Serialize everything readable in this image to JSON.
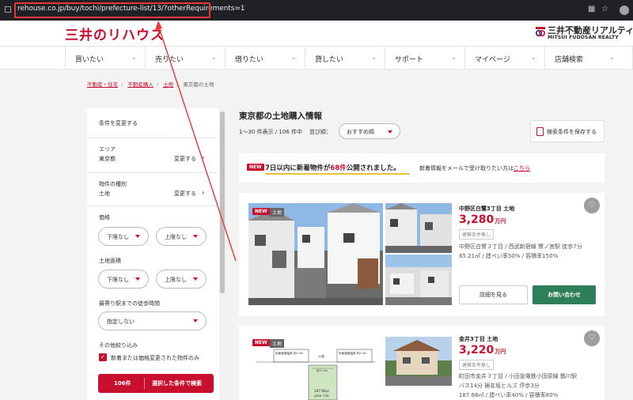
{
  "browser": {
    "url": "rehouse.co.jp/buy/tochi/prefecture-list/13/?otherRequirements=1"
  },
  "header": {
    "logo_text": "三井のリハウス",
    "company_name": "三井不動産リアルティ",
    "company_name_en": "MITSUI FUDOSAN REALTY"
  },
  "nav": {
    "items": [
      "買いたい",
      "売りたい",
      "借りたい",
      "貸したい",
      "サポート",
      "マイページ",
      "店舗検索"
    ]
  },
  "breadcrumb": {
    "items": [
      "不動産・住宅",
      "不動産購入",
      "土地",
      "東京都の土地"
    ]
  },
  "sidebar": {
    "change_conditions": "条件を変更する",
    "area_label": "エリア",
    "area_value": "東京都",
    "change_link": "変更する",
    "type_label": "物件の種別",
    "type_value": "土地",
    "price_label": "価格",
    "min_option": "下限なし",
    "max_option": "上限なし",
    "land_area_label": "土地面積",
    "walk_label": "最寄り駅までの徒歩時間",
    "walk_option": "指定しない",
    "other_label": "その他絞り込み",
    "price_changed_only": "新着または価格変更された物件のみ",
    "search_count": "106件",
    "search_label": "選択した条件で検索"
  },
  "main": {
    "title": "東京都の土地購入情報",
    "count_text": "1～30 件表示 / 106 件中",
    "sort_label": "並び順：",
    "sort_value": "おすすめ順",
    "save_search": "検索条件を保存する"
  },
  "notice": {
    "badge": "NEW",
    "msg_before": "7日以内に新着物件が",
    "msg_highlight": "68件",
    "msg_after": "公開されました。",
    "mail_text": "新着情報をメールで受け取りたい方は",
    "mail_link": "こちら"
  },
  "listings": [
    {
      "badge_new": "NEW",
      "badge_type": "土地",
      "title": "中野区白鷺3丁目 土地",
      "price": "3,280",
      "unit": "万円",
      "tag": "建築条件無し",
      "line1": "中野区白鷺３丁目 / 西武新宿線 鷺ノ宮駅 徒歩7分",
      "line2": "65.21㎡ / 建ぺい率50% / 容積率150%",
      "detail_button": "詳細を見る",
      "contact_button": "お問い合わせ"
    },
    {
      "badge_new": "NEW",
      "badge_type": "土地",
      "title": "金井3丁目 土地",
      "price": "3,220",
      "unit": "万円",
      "tag": "建築条件無し",
      "line1": "町田市金井３丁目 / 小田急電鉄小田原線 鶴川駅",
      "line2": "バス14分 裾名坂ヒルズ 停歩3分",
      "line3": "187.68㎡ / 建ぺい率40% / 容積率80%"
    }
  ],
  "floorplan": {
    "road1": "前面道路幅員 約5.0m",
    "road2": "前面道路幅員 約5.0m",
    "road_public": "公道",
    "area": "187.68㎡",
    "area_sub": "(約56.77坪)",
    "dim": "約11.5m"
  },
  "colors": {
    "brand_red": "#c8102e",
    "contact_green": "#2e7d5b",
    "annotation_red": "#e53935"
  }
}
